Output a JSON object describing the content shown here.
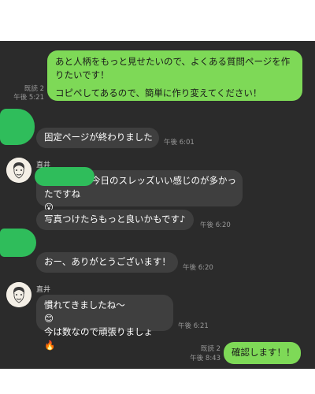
{
  "messages": {
    "m1": {
      "line1": "あと人柄をもっと見せたいので、よくある質問ページを作",
      "line2": "りたいです！",
      "line3": "コピペしてあるので、簡単に作り変えてください！",
      "read": "既読 2",
      "time": "午後 5:21"
    },
    "m2": {
      "text": "固定ページが終わりました",
      "time": "午後 6:01"
    },
    "m3": {
      "sender": "直井",
      "line1": "今日のスレッズいい感じのが多かっ",
      "line2": "たですね",
      "emoji": "😮"
    },
    "m4": {
      "text": "写真つけたらもっと良いかもです♪",
      "time": "午後 6:20"
    },
    "m5": {
      "text": "おー、ありがとうございます！",
      "time": "午後 6:20"
    },
    "m6": {
      "sender": "直井",
      "line1": "慣れてきましたね〜",
      "emoji1": "😊",
      "line2": "今は数なので頑張りましょ",
      "emoji2": "🔥",
      "time": "午後 6:21"
    },
    "m7": {
      "text": "確認します！！",
      "read": "既読 2",
      "time": "午後 8:43"
    }
  },
  "colors": {
    "chat_bg": "#2b2b2b",
    "incoming_bubble": "#3f3f3f",
    "outgoing_bubble": "#7ed957",
    "redaction": "#2fbd5b"
  }
}
